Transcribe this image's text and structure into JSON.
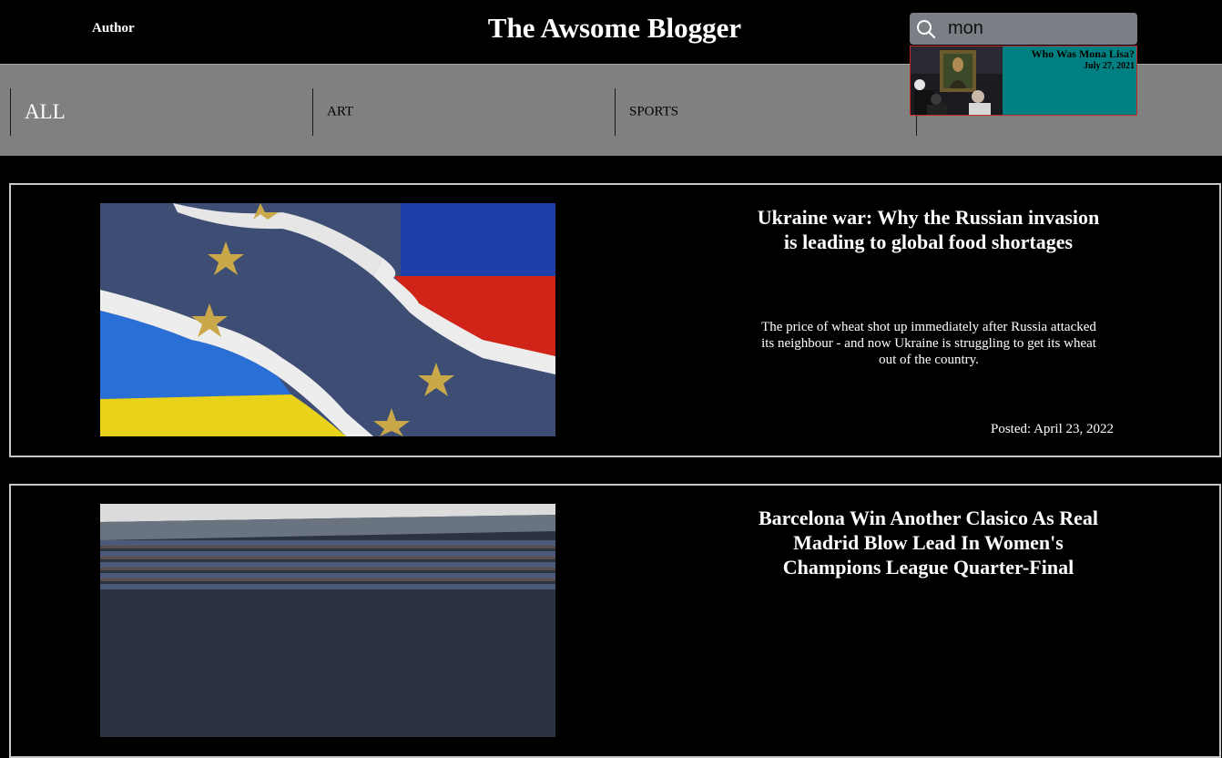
{
  "header": {
    "author_link": "Author",
    "site_title": "The Awsome Blogger"
  },
  "search": {
    "icon": "search-icon",
    "value": "mon",
    "results": [
      {
        "title": "Who Was Mona Lisa?",
        "date": "July 27, 2021"
      }
    ]
  },
  "nav": {
    "items": [
      {
        "label": "ALL"
      },
      {
        "label": "ART"
      },
      {
        "label": "SPORTS"
      }
    ]
  },
  "posts": [
    {
      "title": "Ukraine war: Why the Russian invasion is leading to global food shortages",
      "excerpt": "The price of wheat shot up immediately after Russia attacked its neighbour - and now Ukraine is struggling to get its wheat out of the country.",
      "date": "Posted: April 23, 2022"
    },
    {
      "title": "Barcelona Win Another Clasico As Real Madrid Blow Lead In Women's Champions League Quarter-Final"
    }
  ],
  "colors": {
    "background": "#000000",
    "nav_background": "#808080",
    "search_background": "#7b7e85",
    "result_background": "#008080",
    "result_border": "#c62828"
  }
}
